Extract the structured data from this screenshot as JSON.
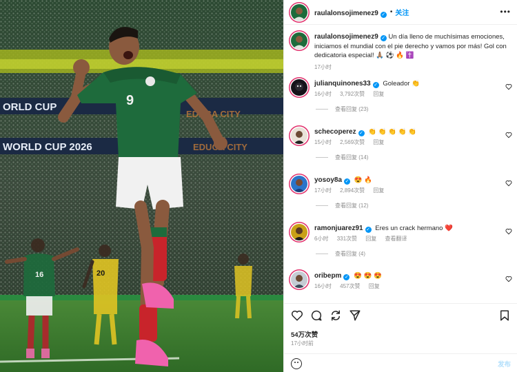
{
  "post": {
    "username": "raulalonsojimenez9",
    "follow_label": "关注",
    "more_label": "•••",
    "caption": "Un día lleno de muchísimas emociones, iniciamos el mundial con el pie derecho y vamos por más! Gol con dedicatoria especial! 🙏🏽 ⚽ 🔥 ✝️",
    "caption_time": "17小时"
  },
  "comments": [
    {
      "user": "julianquinones33",
      "text": "Goleador 👏",
      "time": "16小时",
      "likes": "3,792次赞",
      "reply_label": "回复",
      "view_replies": "查看回复 (23)"
    },
    {
      "user": "schecoperez",
      "text": "👏 👏 👏 👏 👏",
      "time": "15小时",
      "likes": "2,569次赞",
      "reply_label": "回复",
      "view_replies": "查看回复 (14)"
    },
    {
      "user": "yosoy8a",
      "text": "😍 🔥",
      "time": "17小时",
      "likes": "2,894次赞",
      "reply_label": "回复",
      "view_replies": "查看回复 (12)"
    },
    {
      "user": "ramonjuarez91",
      "text": "Eres un crack hermano ❤️",
      "time": "6小时",
      "likes": "331次赞",
      "reply_label": "回复",
      "translate_label": "查看翻译",
      "view_replies": "查看回复 (4)"
    },
    {
      "user": "oribepm",
      "text": "😍 😍 😍",
      "time": "16小时",
      "likes": "457次赞",
      "reply_label": "回复"
    }
  ],
  "footer": {
    "likes": "54万次赞",
    "time": "17小时前",
    "post_label": "发布"
  },
  "colors": {
    "accent": "#0095f6",
    "jersey": "#1e6b3c",
    "pitch": "#3f7a2e"
  },
  "icons": [
    "heart-icon",
    "comment-icon",
    "share-icon",
    "send-icon",
    "bookmark-icon",
    "emoji-icon",
    "verified-icon",
    "more-icon"
  ]
}
